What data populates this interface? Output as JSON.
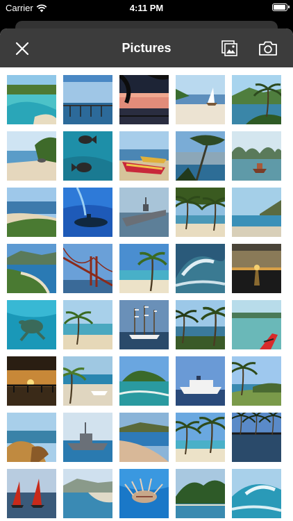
{
  "status": {
    "carrier": "Carrier",
    "time": "4:11 PM",
    "battery_level": 1.0
  },
  "header": {
    "title": "Pictures"
  },
  "icons": {
    "close": "close-icon",
    "gallery": "photo-library-icon",
    "camera": "camera-icon"
  },
  "thumbnails": [
    {
      "subject": "tropical-lagoon-bay"
    },
    {
      "subject": "pier-on-sea"
    },
    {
      "subject": "sunset-through-palm"
    },
    {
      "subject": "sailboat-on-beach"
    },
    {
      "subject": "palm-on-cliff-coast"
    },
    {
      "subject": "beach-with-rocks"
    },
    {
      "subject": "fish-underwater"
    },
    {
      "subject": "boats-on-sand"
    },
    {
      "subject": "tree-by-lake"
    },
    {
      "subject": "karst-islands-boat"
    },
    {
      "subject": "hillside-beach"
    },
    {
      "subject": "submarine-underwater"
    },
    {
      "subject": "aircraft-carrier"
    },
    {
      "subject": "palm-shaded-beach"
    },
    {
      "subject": "rocky-headland-sea"
    },
    {
      "subject": "curving-bay-beach"
    },
    {
      "subject": "suspension-bridge"
    },
    {
      "subject": "palm-over-beach"
    },
    {
      "subject": "breaking-wave"
    },
    {
      "subject": "sunset-over-sea"
    },
    {
      "subject": "sea-turtle"
    },
    {
      "subject": "palm-island-beach"
    },
    {
      "subject": "tall-ship"
    },
    {
      "subject": "palms-on-coast"
    },
    {
      "subject": "kayak-on-lake"
    },
    {
      "subject": "sunset-pier"
    },
    {
      "subject": "palm-and-boat-beach"
    },
    {
      "subject": "green-island"
    },
    {
      "subject": "cruise-ship"
    },
    {
      "subject": "palms-on-headland"
    },
    {
      "subject": "rocky-shore"
    },
    {
      "subject": "warship-at-sea"
    },
    {
      "subject": "coastal-beach"
    },
    {
      "subject": "palm-beach"
    },
    {
      "subject": "palm-reflection-lake"
    },
    {
      "subject": "red-sailboats"
    },
    {
      "subject": "coastal-town-bay"
    },
    {
      "subject": "lionfish"
    },
    {
      "subject": "forested-shore"
    },
    {
      "subject": "surfing-wave"
    }
  ]
}
